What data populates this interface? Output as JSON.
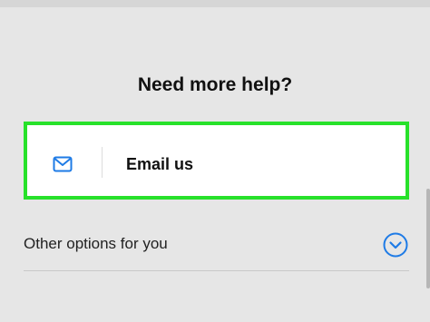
{
  "help": {
    "heading": "Need more help?",
    "email": {
      "label": "Email us",
      "icon": "envelope-icon"
    },
    "options": {
      "label": "Other options for you",
      "icon": "chevron-down-circle-icon"
    }
  },
  "colors": {
    "highlight_border": "#27e12a",
    "accent_blue": "#1e7be6",
    "background": "#e6e6e6"
  }
}
